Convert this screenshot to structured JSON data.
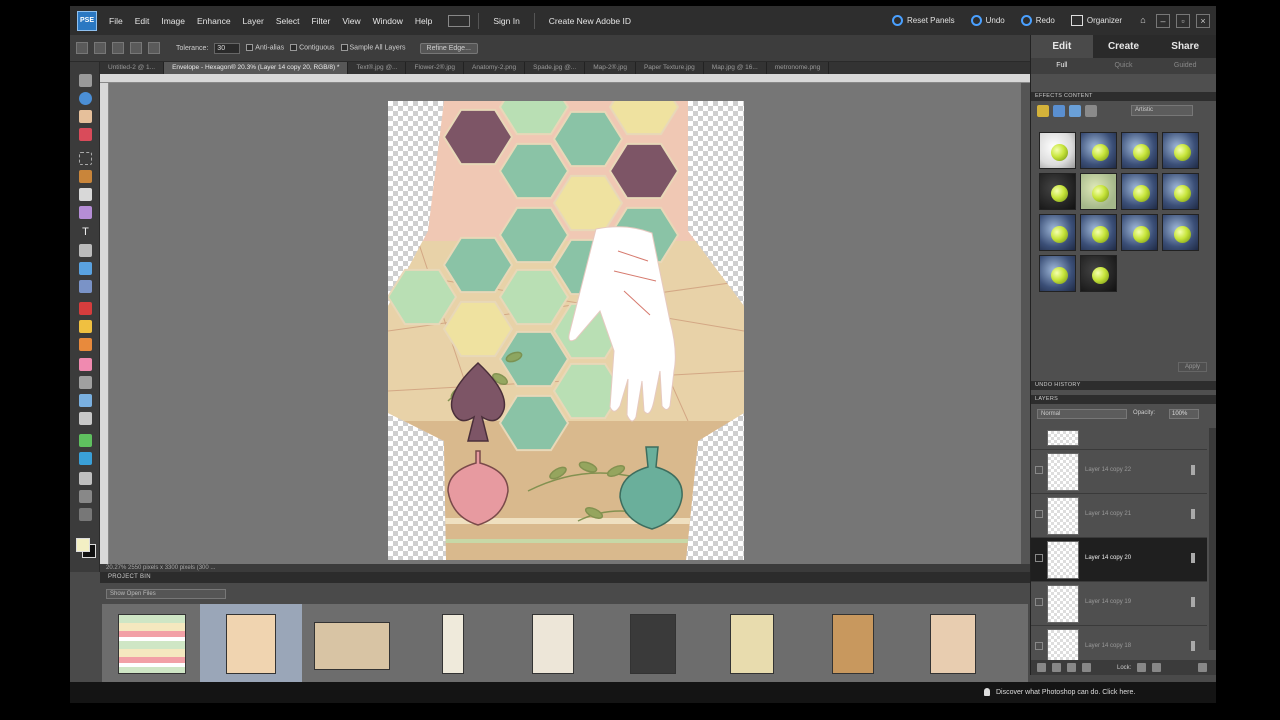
{
  "menubar": {
    "logo": "PSE",
    "items": [
      "File",
      "Edit",
      "Image",
      "Enhance",
      "Layer",
      "Select",
      "Filter",
      "View",
      "Window",
      "Help"
    ],
    "sign_in": "Sign In",
    "create_id": "Create New Adobe ID",
    "reset_panels": "Reset Panels",
    "undo": "Undo",
    "redo": "Redo",
    "organizer": "Organizer"
  },
  "options": {
    "tolerance_label": "Tolerance:",
    "tolerance_value": "30",
    "anti_alias": "Anti-alias",
    "contiguous": "Contiguous",
    "sample_all_layers": "Sample All Layers",
    "refine_edge": "Refine Edge..."
  },
  "doc_tabs": [
    {
      "label": "Untitled-2 @ 1...",
      "active": false
    },
    {
      "label": "Envelope - Hexagon® 20.3% (Layer 14 copy 20, RGB/8) *",
      "active": true
    },
    {
      "label": "Text®.jpg @...",
      "active": false
    },
    {
      "label": "Flower-2®.jpg",
      "active": false
    },
    {
      "label": "Anatomy-2.png",
      "active": false
    },
    {
      "label": "Spade.jpg @...",
      "active": false
    },
    {
      "label": "Map-2®.jpg",
      "active": false
    },
    {
      "label": "Paper Texture.jpg",
      "active": false
    },
    {
      "label": "Map.jpg @ 16...",
      "active": false
    },
    {
      "label": "metronome.png",
      "active": false
    }
  ],
  "status_bar": "20.27%     2550 pixels x 3300 pixels (300 ...",
  "project_bin": {
    "title": "PROJECT BIN",
    "dropdown": "Show Open Files"
  },
  "right_panel": {
    "mode_tabs": [
      "Edit",
      "Create",
      "Share"
    ],
    "sub_tabs": [
      "Full",
      "Quick",
      "Guided"
    ],
    "effects_header": "EFFECTS     CONTENT",
    "effects_filter": "Artistic",
    "apply": "Apply",
    "undo_history_header": "UNDO HISTORY",
    "layers_header": "LAYERS",
    "blend_mode": "Normal",
    "opacity_label": "Opacity:",
    "opacity_value": "100%",
    "lock_label": "Lock:",
    "layers": [
      {
        "name": "Layer 14 copy 22",
        "active": false
      },
      {
        "name": "Layer 14 copy 21",
        "active": false
      },
      {
        "name": "Layer 14 copy 20",
        "active": true
      },
      {
        "name": "Layer 14 copy 19",
        "active": false
      },
      {
        "name": "Layer 14 copy 18",
        "active": false
      }
    ]
  },
  "tip": "Discover what Photoshop can do. Click here.",
  "colors": {
    "foreground": "#f3efc4",
    "background": "#111111",
    "hex_mauve": "#7d5566",
    "hex_mint": "#8ac3a6",
    "hex_pale_green": "#b9dfb4",
    "hex_yellow": "#efe2a0",
    "kraft": "#d9b98d",
    "peach": "#f0c8b4"
  }
}
